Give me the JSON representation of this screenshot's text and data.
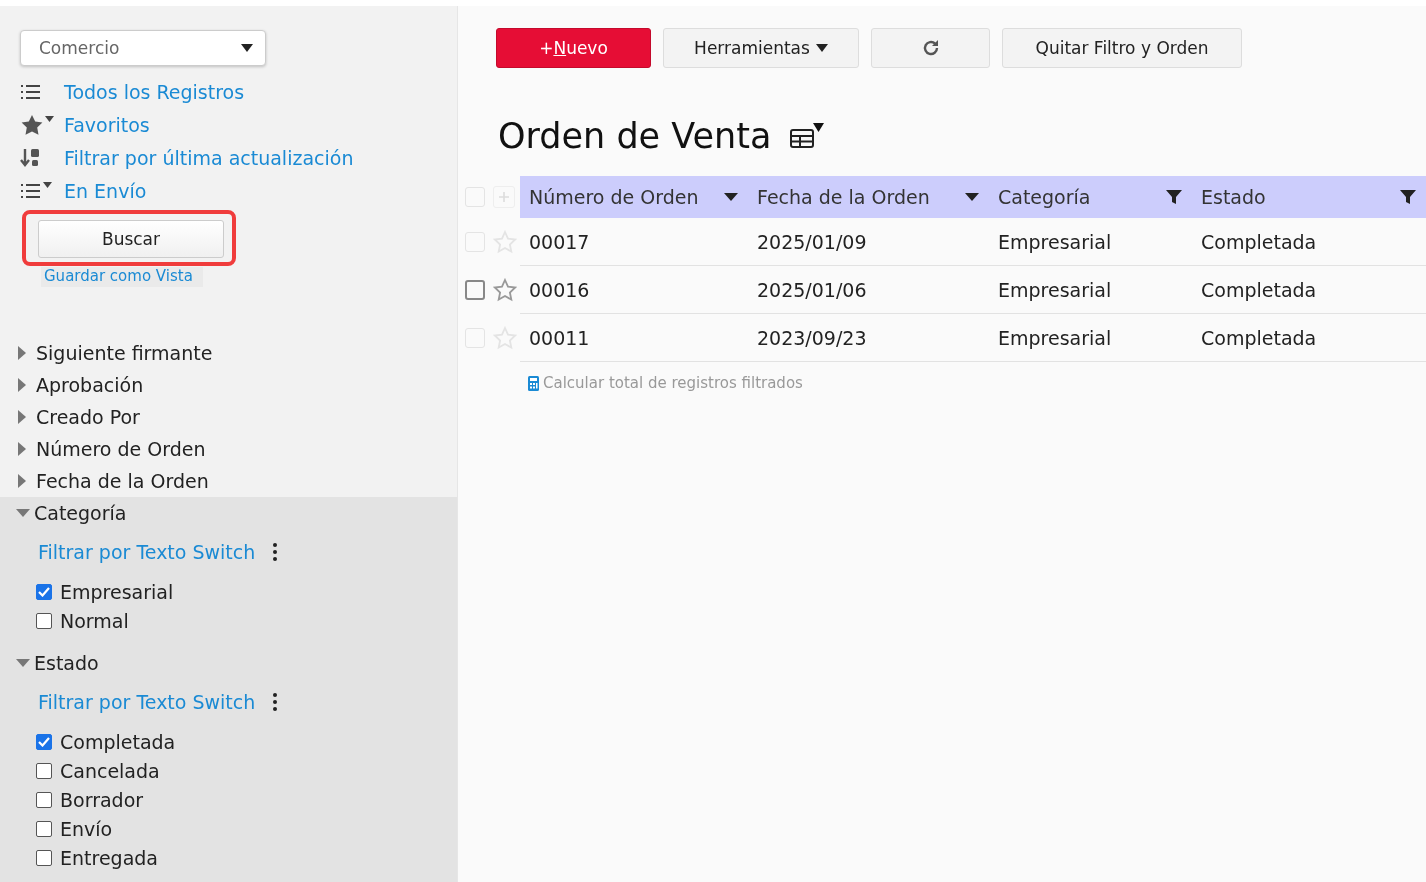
{
  "source_dropdown": {
    "value": "Comercio"
  },
  "views": [
    {
      "kind": "list",
      "label": "Todos los Registros"
    },
    {
      "kind": "star",
      "label": "Favoritos"
    },
    {
      "kind": "sort",
      "label": "Filtrar por última actualización"
    },
    {
      "kind": "list-filter",
      "label": "En Envío"
    }
  ],
  "search_button": "Buscar",
  "save_view_link": "Guardar como Vista",
  "filters": [
    {
      "label": "Siguiente firmante",
      "expanded": false
    },
    {
      "label": "Aprobación",
      "expanded": false
    },
    {
      "label": "Creado Por",
      "expanded": false
    },
    {
      "label": "Número de Orden",
      "expanded": false
    },
    {
      "label": "Fecha de la Orden",
      "expanded": false
    },
    {
      "label": "Categoría",
      "expanded": true,
      "switch_link": "Filtrar por Texto Switch",
      "options": [
        {
          "label": "Empresarial",
          "checked": true
        },
        {
          "label": "Normal",
          "checked": false
        }
      ]
    },
    {
      "label": "Estado",
      "expanded": true,
      "switch_link": "Filtrar por Texto Switch",
      "options": [
        {
          "label": "Completada",
          "checked": true
        },
        {
          "label": "Cancelada",
          "checked": false
        },
        {
          "label": "Borrador",
          "checked": false
        },
        {
          "label": "Envío",
          "checked": false
        },
        {
          "label": "Entregada",
          "checked": false
        }
      ]
    }
  ],
  "toolbar": {
    "new_button": {
      "before": "+",
      "accesskey": "N",
      "after": "uevo"
    },
    "tools_button": "Herramientas",
    "clear_button": "Quitar Filtro y Orden"
  },
  "page_title": "Orden de Venta",
  "table": {
    "select_all_checked": false,
    "columns": [
      {
        "label": "Número de Orden",
        "kind": "sort"
      },
      {
        "label": "Fecha de la Orden",
        "kind": "sort"
      },
      {
        "label": "Categoría",
        "kind": "filter"
      },
      {
        "label": "Estado",
        "kind": "filter"
      }
    ],
    "rows": [
      {
        "hovered": false,
        "checked": false,
        "cells": [
          "00017",
          "2025/01/09",
          "Empresarial",
          "Completada"
        ]
      },
      {
        "hovered": true,
        "checked": false,
        "cells": [
          "00016",
          "2025/01/06",
          "Empresarial",
          "Completada"
        ]
      },
      {
        "hovered": false,
        "checked": false,
        "cells": [
          "00011",
          "2023/09/23",
          "Empresarial",
          "Completada"
        ]
      }
    ]
  },
  "footer_link": "Calcular total de registros filtrados"
}
